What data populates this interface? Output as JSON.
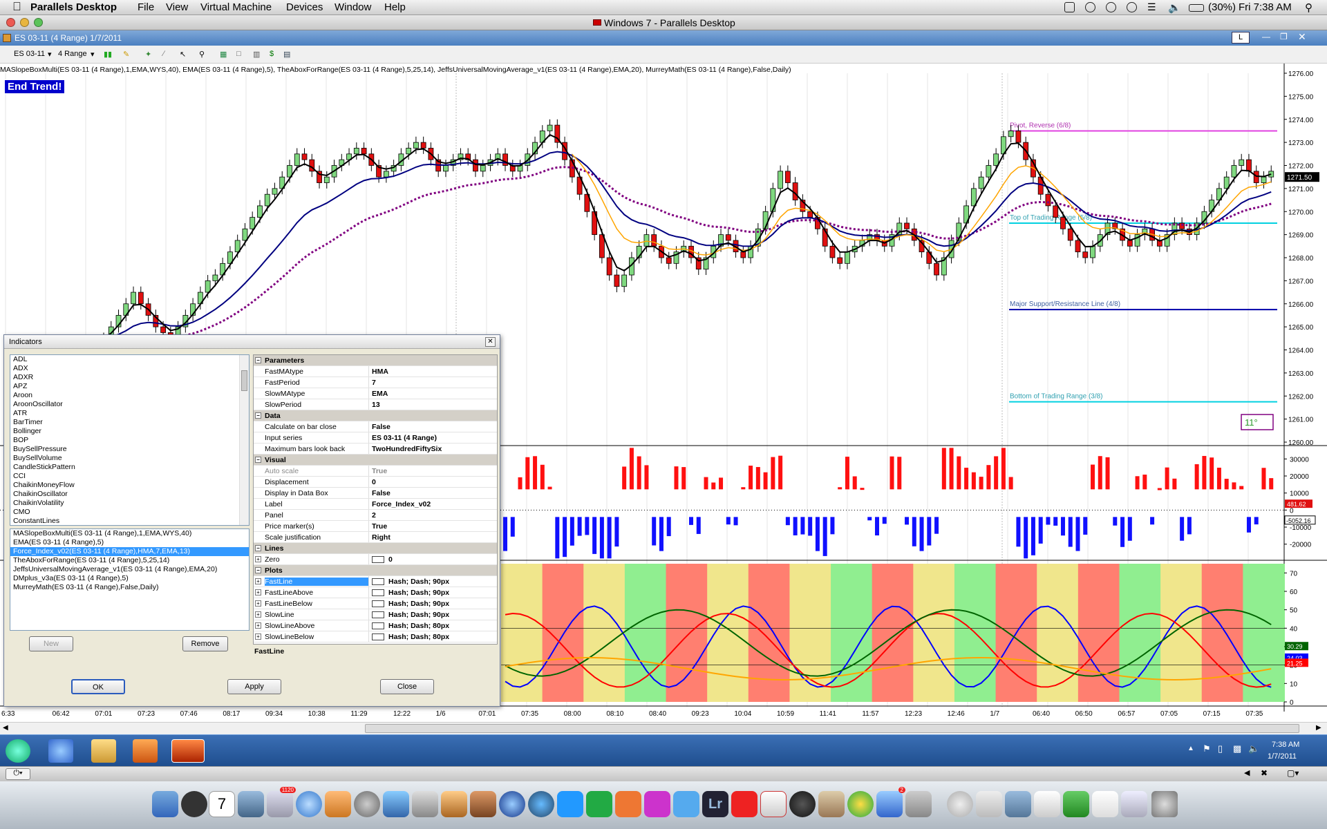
{
  "mac_menubar": {
    "app_name": "Parallels Desktop",
    "menus": [
      "File",
      "View",
      "Virtual Machine",
      "Devices",
      "Window",
      "Help"
    ],
    "battery": "(30%)",
    "clock": "Fri 7:38 AM"
  },
  "parallels_window": {
    "title": "Windows 7 - Parallels Desktop"
  },
  "chart_window": {
    "title": "ES 03-11 (4 Range)  1/7/2011",
    "toolbar": {
      "instrument": "ES 03-11",
      "period": "4 Range"
    },
    "indicators_line": "MASlopeBoxMulti(ES 03-11 (4 Range),1,EMA,WYS,40), EMA(ES 03-11 (4 Range),5), TheAboxForRange(ES 03-11 (4 Range),5,25,14), JeffsUniversalMovingAverage_v1(ES 03-11 (4 Range),EMA,20), MurreyMath(ES 03-11 (4 Range),False,Daily)",
    "end_trend": "End Trend!",
    "angle_badge": "11°",
    "murrey_lines": [
      {
        "label": "Pivot, Reverse (6/8)",
        "price": 1273.5,
        "color": "#e040e0"
      },
      {
        "label": "Top of Trading Range (5/8)",
        "price": 1269.5,
        "color": "#00d0e0"
      },
      {
        "label": "Major Support/Resistance Line (4/8)",
        "price": 1265.75,
        "color": "#0000aa"
      },
      {
        "label": "Bottom of Trading Range (3/8)",
        "price": 1261.75,
        "color": "#00d0e0"
      }
    ],
    "price_axis": [
      "1276.00",
      "1275.00",
      "1274.00",
      "1273.00",
      "1272.00",
      "1271.00",
      "1270.00",
      "1269.00",
      "1268.00",
      "1267.00",
      "1266.00",
      "1265.00",
      "1264.00",
      "1263.00",
      "1262.00",
      "1261.00",
      "1260.00"
    ],
    "price_ticks": [
      1276,
      1275,
      1274,
      1273,
      1272,
      1271,
      1270,
      1269,
      1268,
      1267,
      1266,
      1265,
      1264,
      1263,
      1262,
      1261,
      1260
    ],
    "last_price": "1271.50",
    "force_axis": [
      "30000",
      "20000",
      "10000",
      "0",
      "-10000",
      "-20000"
    ],
    "force_ticks": [
      30000,
      20000,
      10000,
      0,
      -10000,
      -20000
    ],
    "force_values": [
      "481.62",
      "-5052.16"
    ],
    "osc_axis": [
      "70",
      "60",
      "50",
      "40",
      "30",
      "20",
      "10",
      "0"
    ],
    "osc_values": [
      "30.29",
      "24.03",
      "21.25"
    ],
    "time_axis": [
      "6:33",
      "06:42",
      "07:01",
      "07:23",
      "07:46",
      "08:17",
      "09:34",
      "10:38",
      "11:29",
      "12:22",
      "1/6",
      "07:01",
      "07:35",
      "08:00",
      "08:10",
      "08:40",
      "09:23",
      "10:04",
      "10:59",
      "11:41",
      "11:57",
      "12:23",
      "12:46",
      "1/7",
      "06:40",
      "06:50",
      "06:57",
      "07:05",
      "07:15",
      "07:35"
    ]
  },
  "chart_data": {
    "type": "candlestick",
    "title": "ES 03-11 (4 Range)",
    "ylim": [
      1260,
      1276
    ],
    "close": [
      1264.5,
      1265.0,
      1265.5,
      1266.0,
      1266.5,
      1266.0,
      1265.5,
      1265.0,
      1264.75,
      1264.5,
      1265.0,
      1265.5,
      1266.0,
      1266.5,
      1267.0,
      1267.25,
      1267.75,
      1268.25,
      1268.75,
      1269.25,
      1269.75,
      1270.25,
      1270.75,
      1271.0,
      1271.5,
      1272.0,
      1272.5,
      1272.25,
      1271.75,
      1271.25,
      1271.5,
      1272.0,
      1272.25,
      1272.5,
      1272.75,
      1272.5,
      1272.0,
      1271.5,
      1271.75,
      1272.0,
      1272.5,
      1272.75,
      1273.0,
      1272.75,
      1272.25,
      1271.75,
      1272.0,
      1272.25,
      1272.5,
      1272.25,
      1271.75,
      1272.0,
      1272.25,
      1272.5,
      1272.0,
      1271.75,
      1272.0,
      1272.5,
      1273.0,
      1273.5,
      1273.75,
      1273.0,
      1272.25,
      1271.5,
      1270.75,
      1270.0,
      1269.0,
      1268.0,
      1267.25,
      1266.75,
      1267.25,
      1268.0,
      1268.5,
      1269.0,
      1268.5,
      1268.0,
      1267.75,
      1268.25,
      1268.5,
      1268.0,
      1267.5,
      1268.0,
      1268.5,
      1269.0,
      1268.75,
      1268.25,
      1268.0,
      1268.5,
      1269.25,
      1270.0,
      1271.0,
      1271.75,
      1271.25,
      1270.5,
      1270.0,
      1269.75,
      1269.25,
      1268.5,
      1268.0,
      1267.75,
      1268.25,
      1268.5,
      1268.75,
      1269.0,
      1268.75,
      1268.5,
      1269.0,
      1269.5,
      1269.25,
      1268.75,
      1268.25,
      1267.75,
      1267.25,
      1268.0,
      1268.75,
      1269.5,
      1270.25,
      1271.0,
      1271.5,
      1272.0,
      1272.5,
      1273.25,
      1273.5,
      1273.0,
      1272.25,
      1271.5,
      1270.75,
      1270.25,
      1269.75,
      1269.25,
      1268.75,
      1268.25,
      1268.0,
      1268.5,
      1269.0,
      1269.5,
      1269.25,
      1268.75,
      1268.5,
      1269.0,
      1269.25,
      1268.75,
      1268.5,
      1269.0,
      1269.5,
      1269.25,
      1269.0,
      1269.5,
      1270.0,
      1270.5,
      1271.0,
      1271.5,
      1272.0,
      1272.25,
      1271.75,
      1271.25,
      1271.5,
      1271.75
    ],
    "series": [
      {
        "name": "EMA(5)",
        "color": "#000000"
      },
      {
        "name": "JeffsUniversalMovingAverage_v1(EMA,20)",
        "color": "#000080"
      },
      {
        "name": "TheAboxForRange(5,25,14)",
        "color": "#ffa500"
      },
      {
        "name": "MASlopeBoxMulti",
        "color": "#800080"
      }
    ]
  },
  "indicators_dialog": {
    "title": "Indicators",
    "available": [
      "ADL",
      "ADX",
      "ADXR",
      "APZ",
      "Aroon",
      "AroonOscillator",
      "ATR",
      "BarTimer",
      "Bollinger",
      "BOP",
      "BuySellPressure",
      "BuySellVolume",
      "CandleStickPattern",
      "CCI",
      "ChaikinMoneyFlow",
      "ChaikinOscillator",
      "ChaikinVolatility",
      "CMO",
      "ConstantLines"
    ],
    "applied": [
      "MASlopeBoxMulti(ES 03-11 (4 Range),1,EMA,WYS,40)",
      "EMA(ES 03-11 (4 Range),5)",
      "Force_Index_v02(ES 03-11 (4 Range),HMA,7,EMA,13)",
      "TheAboxForRange(ES 03-11 (4 Range),5,25,14)",
      "JeffsUniversalMovingAverage_v1(ES 03-11 (4 Range),EMA,20)",
      "DMplus_v3a(ES 03-11 (4 Range),5)",
      "MurreyMath(ES 03-11 (4 Range),False,Daily)"
    ],
    "selected_applied": 2,
    "buttons": {
      "new": "New",
      "remove": "Remove",
      "ok": "OK",
      "apply": "Apply",
      "close": "Close"
    },
    "properties": [
      {
        "cat": "Parameters"
      },
      {
        "name": "FastMAtype",
        "value": "HMA"
      },
      {
        "name": "FastPeriod",
        "value": "7"
      },
      {
        "name": "SlowMAtype",
        "value": "EMA"
      },
      {
        "name": "SlowPeriod",
        "value": "13"
      },
      {
        "cat": "Data"
      },
      {
        "name": "Calculate on bar close",
        "value": "False"
      },
      {
        "name": "Input series",
        "value": "ES 03-11 (4 Range)"
      },
      {
        "name": "Maximum bars look back",
        "value": "TwoHundredFiftySix"
      },
      {
        "cat": "Visual"
      },
      {
        "name": "Auto scale",
        "value": "True",
        "grey": true
      },
      {
        "name": "Displacement",
        "value": "0"
      },
      {
        "name": "Display in Data Box",
        "value": "False"
      },
      {
        "name": "Label",
        "value": "Force_Index_v02"
      },
      {
        "name": "Panel",
        "value": "2"
      },
      {
        "name": "Price marker(s)",
        "value": "True"
      },
      {
        "name": "Scale justification",
        "value": "Right"
      },
      {
        "cat": "Lines"
      },
      {
        "name": "Zero",
        "value": "0",
        "plus": true
      },
      {
        "cat": "Plots"
      },
      {
        "name": "FastLine",
        "value": "Hash; Dash; 90px",
        "plus": true,
        "selected": true
      },
      {
        "name": "FastLineAbove",
        "value": "Hash; Dash; 90px",
        "plus": true
      },
      {
        "name": "FastLineBelow",
        "value": "Hash; Dash; 90px",
        "plus": true
      },
      {
        "name": "SlowLine",
        "value": "Hash; Dash; 90px",
        "plus": true
      },
      {
        "name": "SlowLineAbove",
        "value": "Hash; Dash; 80px",
        "plus": true
      },
      {
        "name": "SlowLineBelow",
        "value": "Hash; Dash; 80px",
        "plus": true
      }
    ],
    "description_title": "FastLine"
  },
  "win_taskbar": {
    "time": "7:38 AM",
    "date": "1/7/2011"
  },
  "dock": {
    "lr_label": "Lr",
    "mail_badge": "1120",
    "app_store_badge": "2"
  }
}
